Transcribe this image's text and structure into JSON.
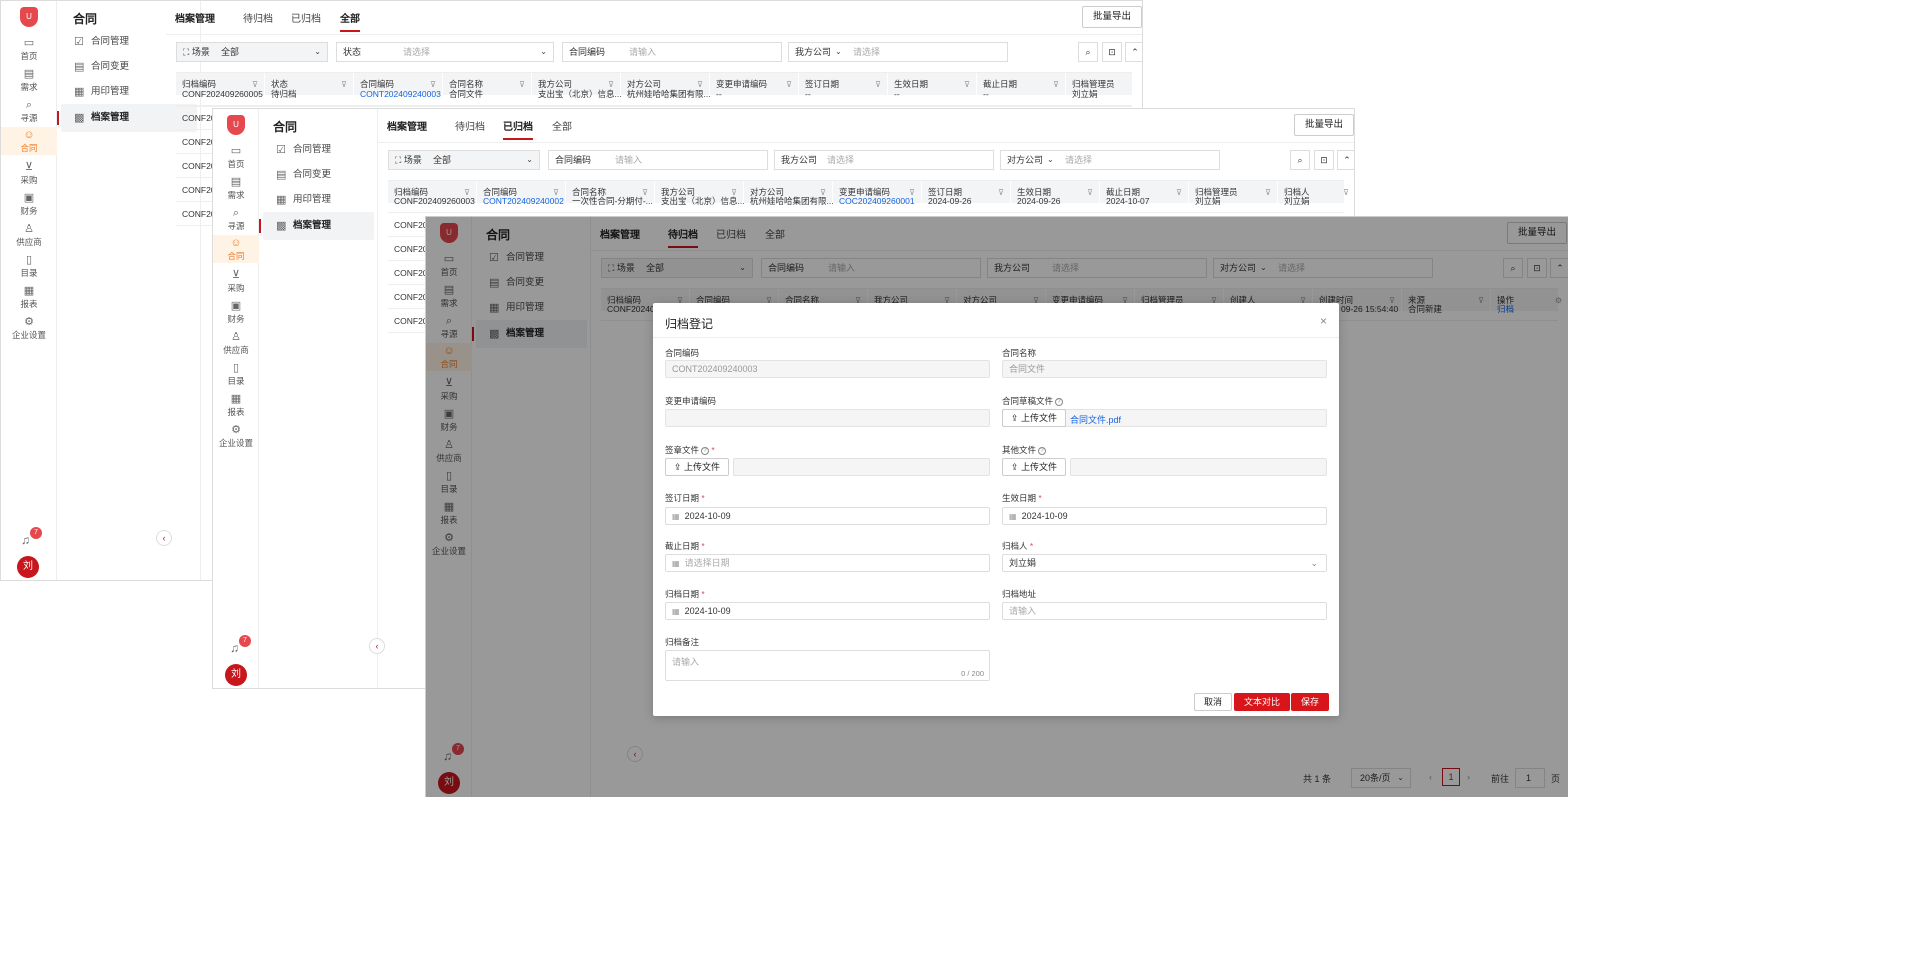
{
  "app": {
    "logo_text": "U",
    "section_title": "合同",
    "nav_rail": [
      "首页",
      "需求",
      "寻源",
      "合同",
      "采购",
      "财务",
      "供应商",
      "目录",
      "报表",
      "企业设置"
    ],
    "side_menu": [
      "合同管理",
      "合同变更",
      "用印管理",
      "档案管理"
    ],
    "notif_count": "7",
    "avatar": "刘",
    "collapse": "‹"
  },
  "common": {
    "tab_archive_mgmt": "档案管理",
    "tab_pending": "待归档",
    "tab_archived": "已归档",
    "tab_all": "全部",
    "export_btn": "批量导出",
    "filter_scene_label": "场景",
    "filter_scene_value": "全部",
    "filter_status_label": "状态",
    "placeholder_select": "请选择",
    "filter_contract_code_label": "合同编码",
    "placeholder_input": "请输入",
    "filter_our_company_label": "我方公司",
    "filter_counter_company_label": "对方公司"
  },
  "win1": {
    "headers": [
      "归档编码",
      "状态",
      "合同编码",
      "合同名称",
      "我方公司",
      "对方公司",
      "变更申请编码",
      "签订日期",
      "生效日期",
      "截止日期",
      "归档管理员"
    ],
    "row": [
      "CONF202409260005",
      "待归档",
      "CONT202409240003",
      "合同文件",
      "支出宝（北京）信息...",
      "杭州娃哈哈集团有限...",
      "--",
      "--",
      "--",
      "--",
      "刘立娟"
    ],
    "partial_rows": [
      "CONF202",
      "CONF202",
      "CONF202",
      "CONF202",
      "CONF202"
    ]
  },
  "win2": {
    "headers": [
      "归档编码",
      "合同编码",
      "合同名称",
      "我方公司",
      "对方公司",
      "变更申请编码",
      "签订日期",
      "生效日期",
      "截止日期",
      "归档管理员",
      "归档人"
    ],
    "row": [
      "CONF202409260003",
      "CONT202409240002",
      "一次性合同-分期付-...",
      "支出宝（北京）信息...",
      "杭州娃哈哈集团有限...",
      "COC202409260001",
      "2024-09-26",
      "2024-09-26",
      "2024-10-07",
      "刘立娟",
      "刘立娟"
    ],
    "partial_rows": [
      "CONF202",
      "CONF202",
      "CONF202",
      "CONF202",
      "CONF202"
    ]
  },
  "win3": {
    "headers": [
      "归档编码",
      "合同编码",
      "合同名称",
      "我方公司",
      "对方公司",
      "变更申请编码",
      "归档管理员",
      "创建人",
      "创建时间",
      "来源",
      "操作"
    ],
    "row_partial": [
      "CONF202409",
      "09-26 15:54:40",
      "合同新建",
      "归档"
    ],
    "pagination": {
      "total": "共 1 条",
      "page_size": "20条/页",
      "page": "1",
      "goto_label": "前往",
      "goto_value": "1",
      "page_suffix": "页"
    }
  },
  "modal": {
    "title": "归档登记",
    "close": "×",
    "contract_code_label": "合同编码",
    "contract_code_value": "CONT202409240003",
    "contract_name_label": "合同名称",
    "contract_name_value": "合同文件",
    "change_code_label": "变更申请编码",
    "draft_file_label": "合同草稿文件",
    "draft_file_name": "合同文件.pdf",
    "upload_label": "上传文件",
    "signed_file_label": "签章文件",
    "other_file_label": "其他文件",
    "sign_date_label": "签订日期",
    "sign_date_value": "2024-10-09",
    "effective_date_label": "生效日期",
    "effective_date_value": "2024-10-09",
    "end_date_label": "截止日期",
    "end_date_placeholder": "请选择日期",
    "archiver_label": "归档人",
    "archiver_value": "刘立娟",
    "archive_date_label": "归档日期",
    "archive_date_value": "2024-10-09",
    "archive_addr_label": "归档地址",
    "archive_addr_placeholder": "请输入",
    "remark_label": "归档备注",
    "remark_placeholder": "请输入",
    "remark_count": "0 / 200",
    "btn_cancel": "取消",
    "btn_compare": "文本对比",
    "btn_save": "保存"
  }
}
